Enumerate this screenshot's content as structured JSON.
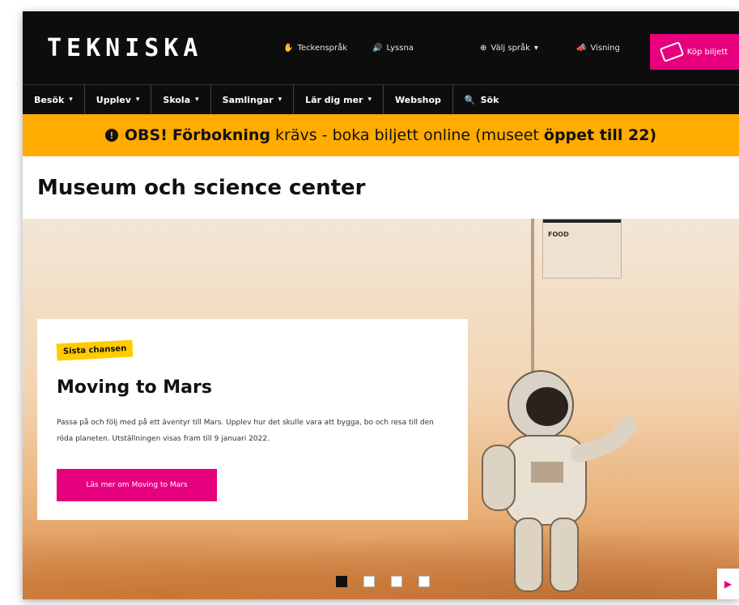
{
  "brand": {
    "logo_text": "TEKNISKA"
  },
  "utility_nav": [
    {
      "label": "Teckenspråk",
      "icon": "hand-icon"
    },
    {
      "label": "Lyssna",
      "icon": "speaker-icon"
    },
    {
      "label": "Välj språk",
      "icon": "globe-icon"
    },
    {
      "label": "Visning",
      "icon": "megaphone-icon"
    }
  ],
  "cta": {
    "label": "Köp biljett"
  },
  "main_nav": [
    {
      "label": "Besök",
      "has_dropdown": true
    },
    {
      "label": "Upplev",
      "has_dropdown": true
    },
    {
      "label": "Skola",
      "has_dropdown": true
    },
    {
      "label": "Samlingar",
      "has_dropdown": true
    },
    {
      "label": "Lär dig mer",
      "has_dropdown": true
    },
    {
      "label": "Webshop",
      "has_dropdown": false
    },
    {
      "label": "Sök",
      "has_dropdown": false
    }
  ],
  "alert": {
    "prefix": "OBS!",
    "text_1": "Förbokning",
    "text_2": "krävs - boka biljett online",
    "text_3": "(museet",
    "text_4": "öppet till 22)"
  },
  "page_title": "Museum och science center",
  "hero": {
    "sign_text": "FOOD",
    "badge": "Sista chansen",
    "title": "Moving to Mars",
    "description": "Passa på och följ med på ett äventyr till Mars. Upplev hur det skulle vara att bygga, bo och resa till den röda planeten. Utställningen visas fram till 9 januari 2022.",
    "button_label": "Läs mer om Moving to Mars",
    "slide_count": 4,
    "active_slide": 1
  },
  "colors": {
    "accent": "#e6007e",
    "alert_bg": "#ffab00",
    "nav_bg": "#0d0d0d",
    "badge_bg": "#ffcc00"
  }
}
